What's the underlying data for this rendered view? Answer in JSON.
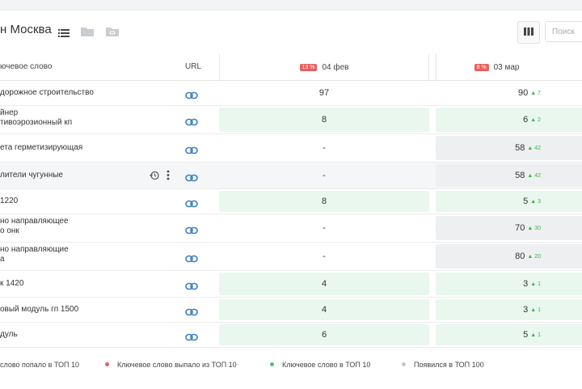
{
  "header": {
    "title": "н Москва",
    "search_placeholder": "Поиск"
  },
  "table": {
    "col_keyword": "ючевое слово",
    "col_url": "URL",
    "col1": {
      "badge": "13 %",
      "date": "04 фев"
    },
    "col2": {
      "badge": "8 %",
      "date": "03 мар"
    }
  },
  "rows": [
    {
      "keyword": "дорожное строительство",
      "c1": "97",
      "c2": "90",
      "c2_change": "▲ 7"
    },
    {
      "keyword": "йнер\nтивоэрозионный кп",
      "c1": "8",
      "c2": "6",
      "c2_change": "▲ 2"
    },
    {
      "keyword": "ета герметизирующая",
      "c1": "-",
      "c2": "58",
      "c2_change": "▲ 42"
    },
    {
      "keyword": "лители чугунные",
      "c1": "-",
      "c2": "58",
      "c2_change": "▲ 42"
    },
    {
      "keyword": "1220",
      "c1": "8",
      "c2": "5",
      "c2_change": "▲ 3"
    },
    {
      "keyword": "но направляющее\nо онк",
      "c1": "-",
      "c2": "70",
      "c2_change": "▲ 30"
    },
    {
      "keyword": "но направляющие\nа",
      "c1": "-",
      "c2": "80",
      "c2_change": "▲ 20"
    },
    {
      "keyword": "к 1420",
      "c1": "4",
      "c2": "3",
      "c2_change": "▲ 1"
    },
    {
      "keyword": "овый модуль гп 1500",
      "c1": "4",
      "c2": "3",
      "c2_change": "▲ 1"
    },
    {
      "keyword": "дуль",
      "c1": "6",
      "c2": "5",
      "c2_change": "▲ 1"
    }
  ],
  "legend": {
    "entered": "слово попало в ТОП 10",
    "dropped": "Ключевое слово выпало из ТОП 10",
    "in_top": "Ключевое слово в ТОП 10",
    "appeared": "Появился в ТОП 100"
  },
  "colors": {
    "accent": "#3d7fc4",
    "green": "#39b54a",
    "red": "#ee5c5c"
  }
}
